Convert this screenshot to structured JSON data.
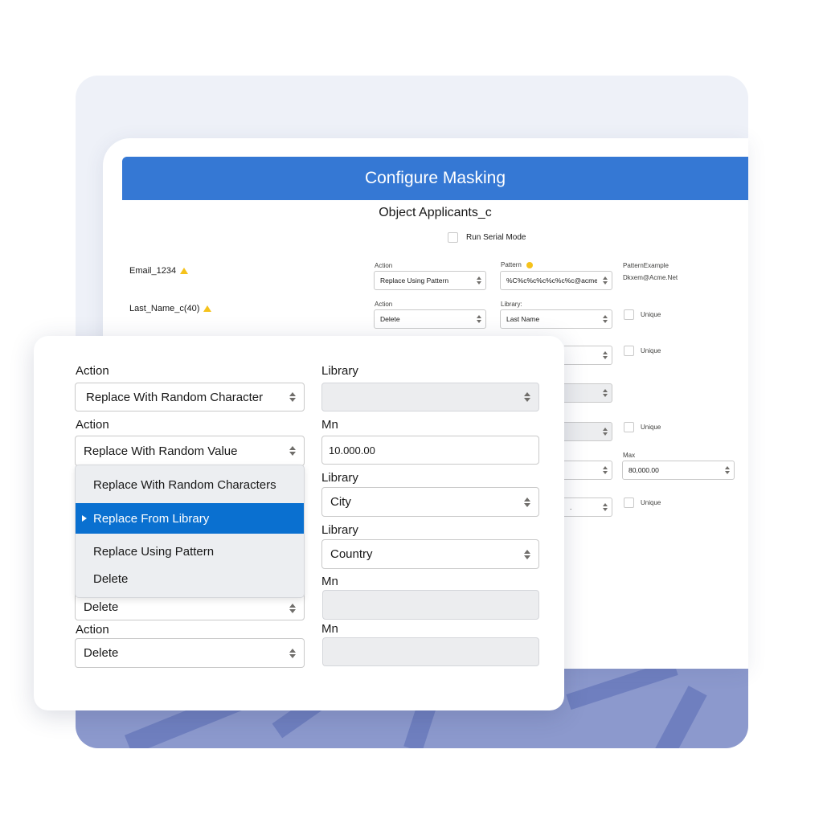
{
  "background_window": {
    "title": "Configure Masking",
    "object_title": "Object Applicants_c",
    "serial_mode_label": "Run Serial Mode",
    "rows": [
      {
        "field": "Email_1234",
        "action_label": "Action",
        "action_value": "Replace Using Pattern",
        "second_label": "Pattern",
        "second_value": "%C%c%c%c%c%c%c@acme.",
        "example_label": "PatternExample",
        "example_value": "Dkxem@Acme.Net"
      },
      {
        "field": "Last_Name_c(40)",
        "action_label": "Action",
        "action_value": "Delete",
        "second_label": "Library:",
        "second_value": "Last Name",
        "unique_label": "Unique"
      }
    ],
    "unique_label": "Unique",
    "max_label": "Max",
    "max_value": "80,000.00",
    "partial_text": "."
  },
  "front_card": {
    "rows": [
      {
        "action_label": "Action",
        "action_value": "Replace With Random Character",
        "right_label": "Library",
        "right_value": ""
      },
      {
        "action_label": "Action",
        "action_value": "Replace With Random Value",
        "right_label": "Mn",
        "right_value": "10.000.00"
      },
      {
        "right_label": "Library",
        "right_value": "City"
      },
      {
        "right_label": "Library",
        "right_value": "Country"
      },
      {
        "action_value": "Delete",
        "right_label": "Mn",
        "right_value": ""
      },
      {
        "action_label": "Action",
        "action_value": "Delete",
        "right_label": "Mn",
        "right_value": ""
      }
    ],
    "dropdown": {
      "options": [
        {
          "label": "Replace With Random Characters",
          "selected": false
        },
        {
          "label": "Replace From Library",
          "selected": true
        },
        {
          "label": "Replace Using Pattern",
          "selected": false
        },
        {
          "label": "Delete",
          "selected": false
        }
      ]
    }
  },
  "colors": {
    "header_blue": "#3578d4",
    "selected_blue": "#0a70d0",
    "warning_yellow": "#f5c21b",
    "wave": "#8c99cd"
  }
}
